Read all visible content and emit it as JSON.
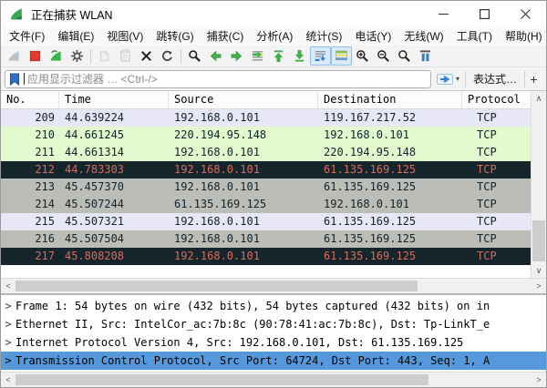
{
  "window": {
    "title": "正在捕获 WLAN",
    "minimize_glyph": "–",
    "close_glyph": "✕"
  },
  "menu_items": [
    "文件(F)",
    "编辑(E)",
    "视图(V)",
    "跳转(G)",
    "捕获(C)",
    "分析(A)",
    "统计(S)",
    "电话(Y)",
    "无线(W)",
    "工具(T)",
    "帮助(H)"
  ],
  "toolbar": {
    "buttons": [
      {
        "name": "start-capture",
        "state": "disabled"
      },
      {
        "name": "stop-capture",
        "state": "enabled"
      },
      {
        "name": "restart-capture",
        "state": "enabled"
      },
      {
        "name": "capture-options",
        "state": "enabled"
      },
      {
        "name": "open-file",
        "state": "disabled"
      },
      {
        "name": "save-file",
        "state": "disabled"
      },
      {
        "name": "close-file",
        "state": "enabled"
      },
      {
        "name": "reload",
        "state": "enabled"
      },
      {
        "name": "find-packet",
        "state": "enabled"
      },
      {
        "name": "go-back",
        "state": "enabled"
      },
      {
        "name": "go-forward",
        "state": "enabled"
      },
      {
        "name": "go-to-packet",
        "state": "enabled"
      },
      {
        "name": "first-packet",
        "state": "enabled"
      },
      {
        "name": "last-packet",
        "state": "enabled"
      },
      {
        "name": "auto-scroll",
        "state": "toggled"
      },
      {
        "name": "colorize",
        "state": "toggled"
      },
      {
        "name": "zoom-in",
        "state": "enabled"
      },
      {
        "name": "zoom-out",
        "state": "enabled"
      },
      {
        "name": "zoom-original",
        "state": "enabled"
      },
      {
        "name": "resize-columns",
        "state": "enabled"
      }
    ]
  },
  "filter_bar": {
    "placeholder": "应用显示过滤器 … <Ctrl-/>",
    "expression_button": "表达式…",
    "add_button": "+",
    "apply_caret": "▾"
  },
  "packet_list": {
    "columns": [
      "No.",
      "Time",
      "Source",
      "Destination",
      "Protocol"
    ],
    "rows": [
      {
        "no": "209",
        "time": "44.639224",
        "source": "192.168.0.101",
        "destination": "119.167.217.52",
        "protocol": "TCP",
        "style": "lavender"
      },
      {
        "no": "210",
        "time": "44.661245",
        "source": "220.194.95.148",
        "destination": "192.168.0.101",
        "protocol": "TCP",
        "style": "green"
      },
      {
        "no": "211",
        "time": "44.661314",
        "source": "192.168.0.101",
        "destination": "220.194.95.148",
        "protocol": "TCP",
        "style": "green"
      },
      {
        "no": "212",
        "time": "44.783303",
        "source": "192.168.0.101",
        "destination": "61.135.169.125",
        "protocol": "TCP",
        "style": "dark"
      },
      {
        "no": "213",
        "time": "45.457370",
        "source": "192.168.0.101",
        "destination": "61.135.169.125",
        "protocol": "TCP",
        "style": "gray"
      },
      {
        "no": "214",
        "time": "45.507244",
        "source": "61.135.169.125",
        "destination": "192.168.0.101",
        "protocol": "TCP",
        "style": "gray"
      },
      {
        "no": "215",
        "time": "45.507321",
        "source": "192.168.0.101",
        "destination": "61.135.169.125",
        "protocol": "TCP",
        "style": "lavender"
      },
      {
        "no": "216",
        "time": "45.507504",
        "source": "192.168.0.101",
        "destination": "61.135.169.125",
        "protocol": "TCP",
        "style": "gray"
      },
      {
        "no": "217",
        "time": "45.808208",
        "source": "192.168.0.101",
        "destination": "61.135.169.125",
        "protocol": "TCP",
        "style": "dark"
      }
    ]
  },
  "detail_pane": {
    "expander": ">",
    "lines": [
      {
        "text": "Frame 1: 54 bytes on wire (432 bits), 54 bytes captured (432 bits) on in",
        "selected": false
      },
      {
        "text": "Ethernet II, Src: IntelCor_ac:7b:8c (90:78:41:ac:7b:8c), Dst: Tp-LinkT_e",
        "selected": false
      },
      {
        "text": "Internet Protocol Version 4, Src: 192.168.0.101, Dst: 61.135.169.125",
        "selected": false
      },
      {
        "text": "Transmission Control Protocol, Src Port: 64724, Dst Port: 443, Seq: 1, A",
        "selected": true
      }
    ]
  },
  "scrollbar_glyphs": {
    "up": "∧",
    "down": "∨",
    "left": "<",
    "right": ">"
  },
  "colors": {
    "row_tcp_lavender": "#e7e7f8",
    "row_green": "#e2fbce",
    "row_syn_fin_gray": "#bdbdb8",
    "row_bad_tcp_bg": "#15252c",
    "row_bad_tcp_text": "#db6a5b",
    "selection_blue": "#5598db",
    "accent_green": "#43b049",
    "stop_red": "#e23b2e",
    "toggle_blue_bg": "#d9ebfa"
  }
}
